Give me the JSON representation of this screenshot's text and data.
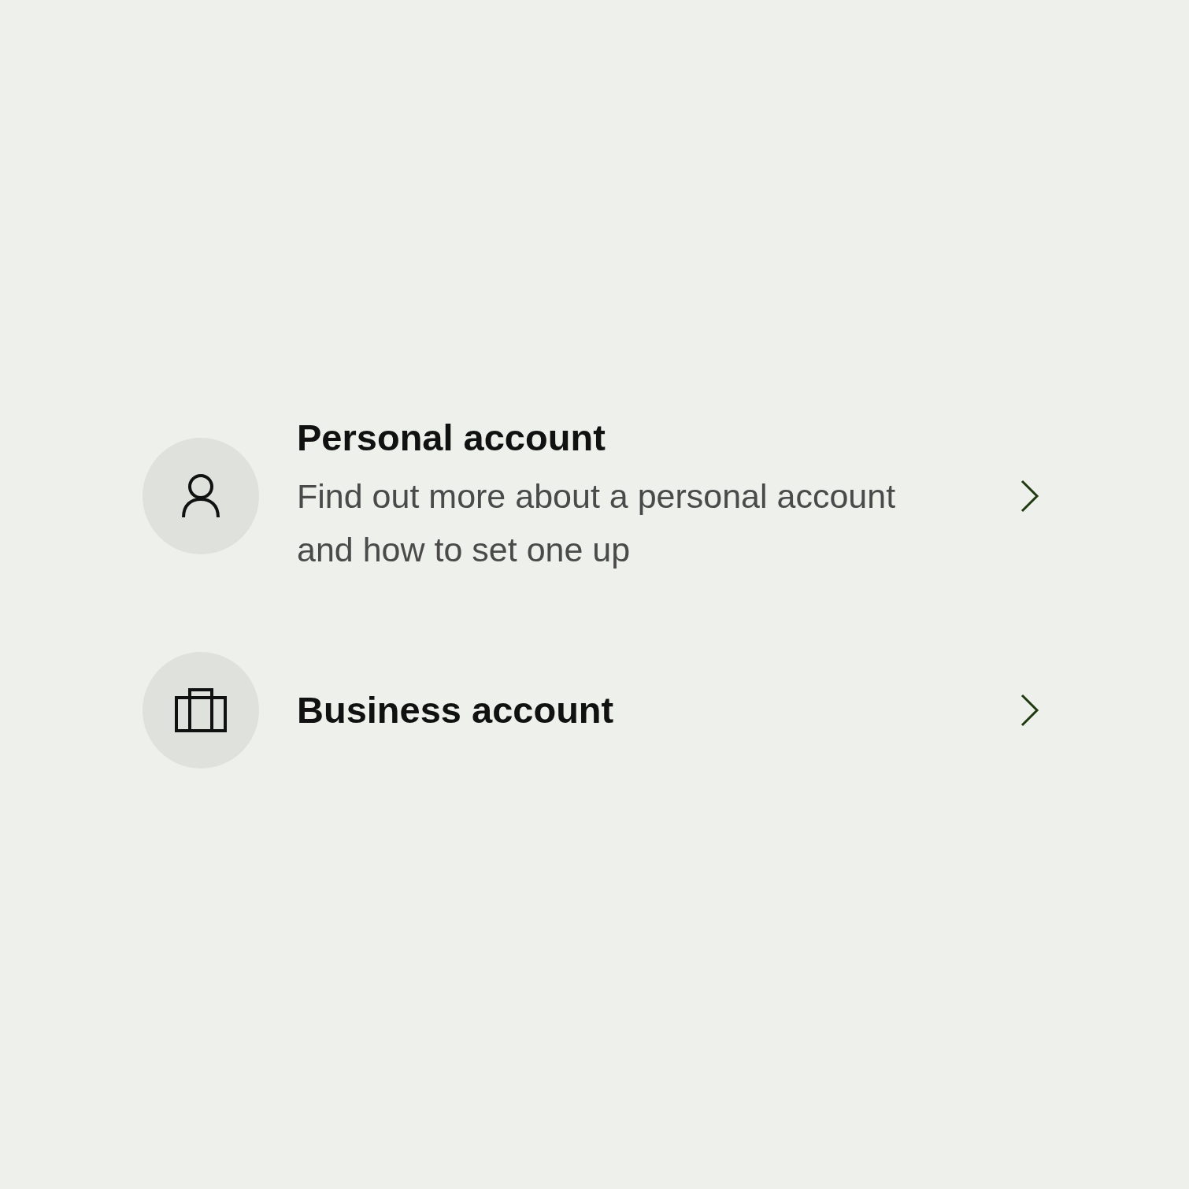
{
  "options": [
    {
      "kind": "person",
      "title": "Personal account",
      "description": "Find out more about a personal account and how to set one up"
    },
    {
      "kind": "business",
      "title": "Business account"
    }
  ]
}
